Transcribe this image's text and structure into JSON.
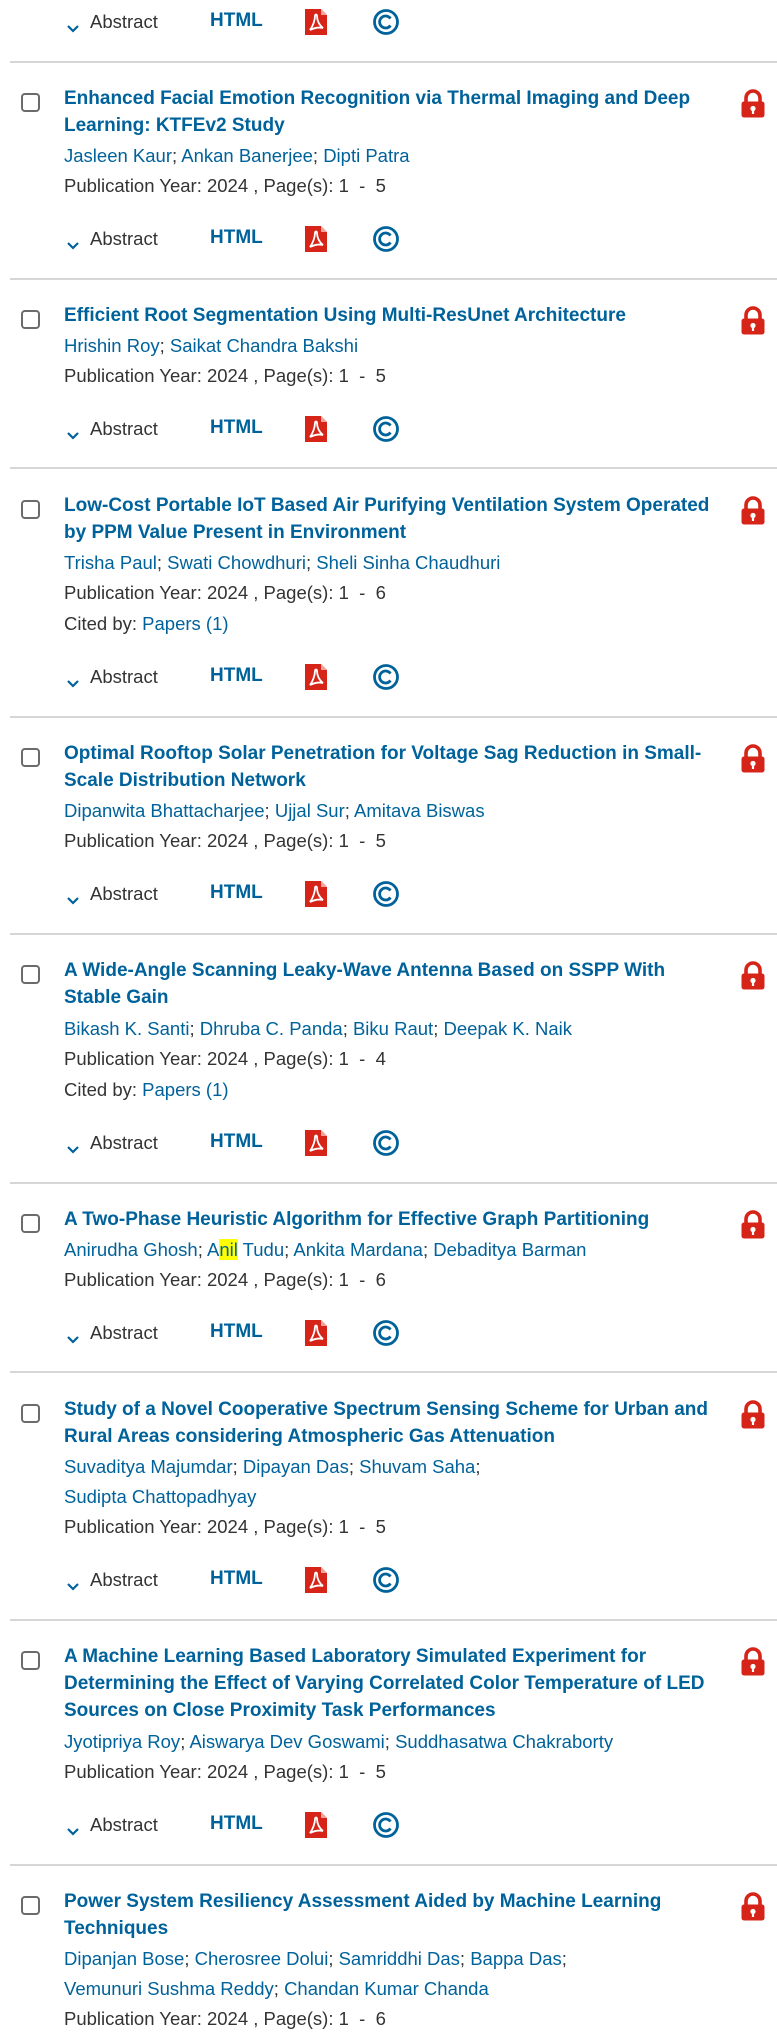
{
  "actions": {
    "abstract_label": "Abstract",
    "html_label": "HTML"
  },
  "colors": {
    "link": "#00629b",
    "lock": "#d62418",
    "pdf": "#d62418",
    "highlight": "#ffff00"
  },
  "items": [
    {
      "title": "",
      "authors": [],
      "meta": "",
      "cited_prefix": "",
      "cited_link": ""
    },
    {
      "title": "Enhanced Facial Emotion Recognition via Thermal Imaging and Deep Learning: KTFEv2 Study",
      "authors": [
        "Jasleen Kaur",
        "Ankan Banerjee",
        "Dipti Patra"
      ],
      "meta": "Publication Year: 2024 , Page(s): 1  -  5",
      "cited_prefix": "",
      "cited_link": ""
    },
    {
      "title": "Efficient Root Segmentation Using Multi-ResUnet Architecture",
      "authors": [
        "Hrishin Roy",
        "Saikat Chandra Bakshi"
      ],
      "meta": "Publication Year: 2024 , Page(s): 1  -  5",
      "cited_prefix": "",
      "cited_link": ""
    },
    {
      "title": "Low-Cost Portable IoT Based Air Purifying Ventilation System Operated by PPM Value Present in Environment",
      "authors": [
        "Trisha Paul",
        "Swati Chowdhuri",
        "Sheli Sinha Chaudhuri"
      ],
      "meta": "Publication Year: 2024 , Page(s): 1  -  6",
      "cited_prefix": "Cited by: ",
      "cited_link": "Papers (1)"
    },
    {
      "title": "Optimal Rooftop Solar Penetration for Voltage Sag Reduction in Small-Scale Distribution Network",
      "authors": [
        "Dipanwita Bhattacharjee",
        "Ujjal Sur",
        "Amitava Biswas"
      ],
      "meta": "Publication Year: 2024 , Page(s): 1  -  5",
      "cited_prefix": "",
      "cited_link": ""
    },
    {
      "title": "A Wide-Angle Scanning Leaky-Wave Antenna Based on SSPP With Stable Gain",
      "authors": [
        "Bikash K. Santi",
        "Dhruba C. Panda",
        "Biku Raut",
        "Deepak K. Naik"
      ],
      "meta": "Publication Year: 2024 , Page(s): 1  -  4",
      "cited_prefix": "Cited by: ",
      "cited_link": "Papers (1)"
    },
    {
      "title": "A Two-Phase Heuristic Algorithm for Effective Graph Partitioning",
      "authors": [
        "Anirudha Ghosh",
        "Anil Tudu",
        "Ankita Mardana",
        "Debaditya Barman"
      ],
      "author_highlight": {
        "author_index": 1,
        "before": "A",
        "mark": "nil",
        "after": " Tudu"
      },
      "meta": "Publication Year: 2024 , Page(s): 1  -  6",
      "cited_prefix": "",
      "cited_link": ""
    },
    {
      "title": "Study of a Novel Cooperative Spectrum Sensing Scheme for Urban and Rural Areas considering Atmospheric Gas Attenuation",
      "authors": [
        "Suvaditya Majumdar",
        "Dipayan Das",
        "Shuvam Saha",
        "Sudipta Chattopadhyay"
      ],
      "meta": "Publication Year: 2024 , Page(s): 1  -  5",
      "cited_prefix": "",
      "cited_link": ""
    },
    {
      "title": "A Machine Learning Based Laboratory Simulated Experiment for Determining the Effect of Varying Correlated Color Temperature of LED Sources on Close Proximity Task Performances",
      "authors": [
        "Jyotipriya Roy",
        "Aiswarya Dev Goswami",
        "Suddhasatwa Chakraborty"
      ],
      "meta": "Publication Year: 2024 , Page(s): 1  -  5",
      "cited_prefix": "",
      "cited_link": ""
    },
    {
      "title": "Power System Resiliency Assessment Aided by Machine Learning Techniques",
      "authors": [
        "Dipanjan Bose",
        "Cherosree Dolui",
        "Samriddhi Das",
        "Bappa Das",
        "Vemunuri Sushma Reddy",
        "Chandan Kumar Chanda"
      ],
      "meta": "Publication Year: 2024 , Page(s): 1  -  6",
      "cited_prefix": "",
      "cited_link": ""
    }
  ]
}
